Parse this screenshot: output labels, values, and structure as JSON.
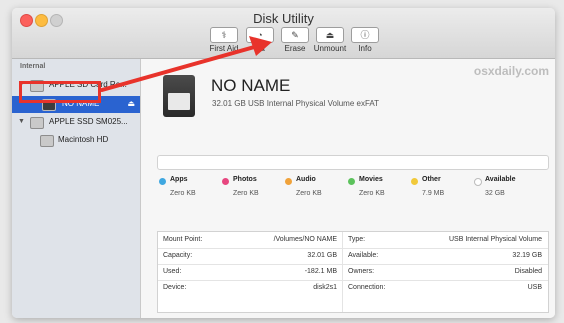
{
  "window": {
    "title": "Disk Utility"
  },
  "toolbar": {
    "first_aid": {
      "label": "First Aid",
      "icon": "stethoscope-icon"
    },
    "partition": {
      "label": "Pa",
      "icon": "pie-icon"
    },
    "erase": {
      "label": "Erase",
      "icon": "eraser-icon"
    },
    "unmount": {
      "label": "Unmount",
      "icon": "eject-icon"
    },
    "info": {
      "label": "Info",
      "icon": "info-icon"
    }
  },
  "sidebar": {
    "header": "Internal",
    "items": [
      {
        "label": "APPLE SD Card Re..."
      },
      {
        "label": "NO NAME",
        "selected": true
      },
      {
        "label": "APPLE SSD SM025..."
      },
      {
        "label": "Macintosh HD"
      }
    ]
  },
  "volume": {
    "name": "NO NAME",
    "description": "32.01 GB USB Internal Physical Volume exFAT"
  },
  "watermark": "osxdaily.com",
  "legend": [
    {
      "name": "Apps",
      "size": "Zero KB",
      "color": "#3fa7e0"
    },
    {
      "name": "Photos",
      "size": "Zero KB",
      "color": "#e7467f"
    },
    {
      "name": "Audio",
      "size": "Zero KB",
      "color": "#f0a23a"
    },
    {
      "name": "Movies",
      "size": "Zero KB",
      "color": "#5cc25c"
    },
    {
      "name": "Other",
      "size": "7.9 MB",
      "color": "#f1c93a"
    },
    {
      "name": "Available",
      "size": "32 GB",
      "color": "#ffffff"
    }
  ],
  "info": [
    {
      "k1": "Mount Point:",
      "v1": "/Volumes/NO NAME",
      "k2": "Type:",
      "v2": "USB Internal Physical Volume"
    },
    {
      "k1": "Capacity:",
      "v1": "32.01 GB",
      "k2": "Available:",
      "v2": "32.19 GB"
    },
    {
      "k1": "Used:",
      "v1": "-182.1 MB",
      "k2": "Owners:",
      "v2": "Disabled"
    },
    {
      "k1": "Device:",
      "v1": "disk2s1",
      "k2": "Connection:",
      "v2": "USB"
    }
  ],
  "colors": {
    "accent": "#2a63d0",
    "annotation": "#e8332b"
  }
}
